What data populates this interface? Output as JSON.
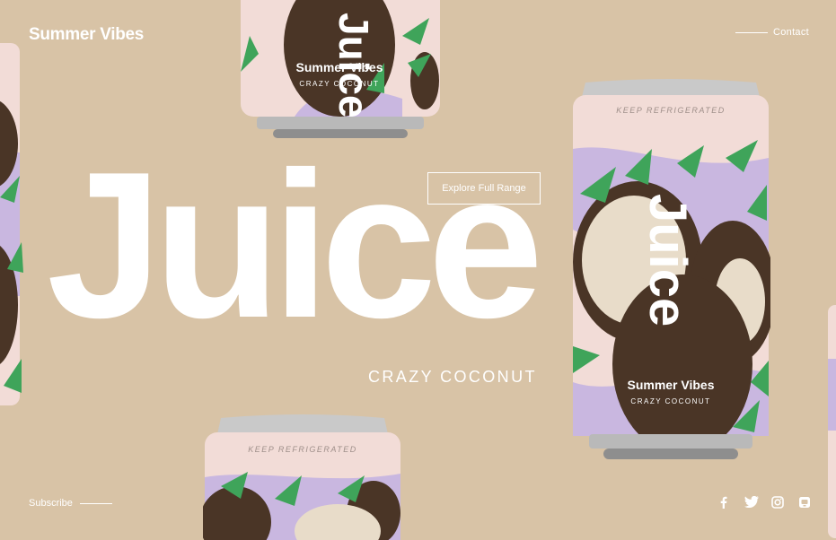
{
  "header": {
    "brand": "Summer Vibes",
    "contact_label": "Contact"
  },
  "hero": {
    "title": "Juice",
    "subtitle": "CRAZY COCONUT",
    "cta_label": "Explore Full Range"
  },
  "cans": {
    "brand": "Summer Vibes",
    "flavor": "CRAZY COCONUT",
    "product_word": "Juice",
    "top_text": "KEEP REFRIGERATED"
  },
  "footer": {
    "subscribe_label": "Subscribe",
    "social": [
      {
        "icon": "facebook-icon"
      },
      {
        "icon": "twitter-icon"
      },
      {
        "icon": "instagram-icon"
      },
      {
        "icon": "media-icon"
      }
    ]
  },
  "colors": {
    "background": "#d8c3a6",
    "can_body": "#f2dcd7",
    "coconut": "#4a3526",
    "leaf": "#3fa45a",
    "lavender": "#c9b7e0"
  }
}
